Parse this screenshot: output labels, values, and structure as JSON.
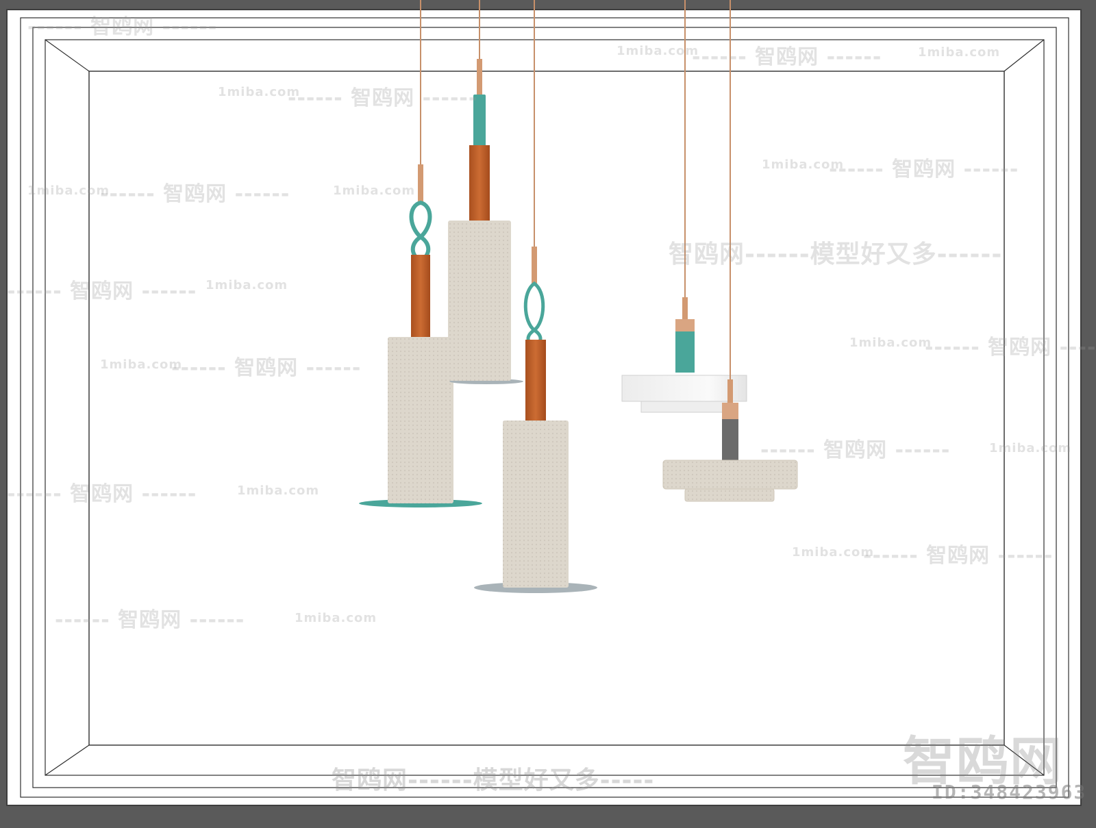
{
  "watermark": {
    "site": "1miba.com",
    "brand": "智鸥网",
    "dash_brand": "------ 智鸥网 ------",
    "slogan": "智鸥网------模型好又多-----",
    "slogan_right": "智鸥网------模型好又多------",
    "corner_brand": "智鸥网",
    "id_label": "ID:348423963"
  },
  "colors": {
    "frame_outer": "#5a5a5a",
    "frame_inner": "#ffffff",
    "cord": "#c7906a",
    "wood": "#c0622a",
    "fabric": "#ddd7cc",
    "teal": "#4aa69a",
    "steel": "#a9b3b8",
    "gray": "#6b6b6b",
    "white_shade": "#f1f1f1"
  },
  "objects": [
    {
      "name": "pendant-lamp-tall-left",
      "shade": "fabric-cylinder",
      "accent": "teal-loop",
      "base_disc": "teal"
    },
    {
      "name": "pendant-lamp-tall-middle",
      "shade": "fabric-cylinder",
      "accent": "teal-strap",
      "base_disc": "steel"
    },
    {
      "name": "pendant-lamp-tall-right",
      "shade": "fabric-cylinder",
      "accent": "teal-loop",
      "base_disc": "steel"
    },
    {
      "name": "pendant-lamp-disc-white",
      "shade": "white-disc",
      "accent": "teal-collar"
    },
    {
      "name": "pendant-lamp-disc-fabric",
      "shade": "fabric-disc",
      "accent": "gray-collar"
    }
  ]
}
